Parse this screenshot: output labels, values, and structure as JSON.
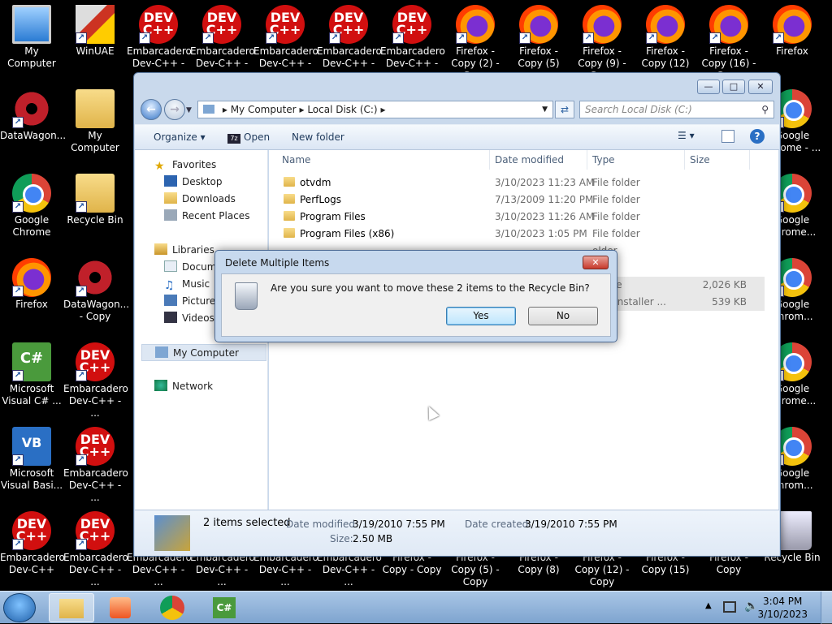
{
  "desktop": {
    "icons": [
      {
        "label": "My Computer",
        "kind": "pc"
      },
      {
        "label": "WinUAE",
        "kind": "winuae"
      },
      {
        "label": "Embarcadero Dev-C++ - ...",
        "kind": "dev"
      },
      {
        "label": "Embarcadero Dev-C++ - ...",
        "kind": "dev"
      },
      {
        "label": "Embarcadero Dev-C++ - ...",
        "kind": "dev"
      },
      {
        "label": "Embarcadero Dev-C++ - ...",
        "kind": "dev"
      },
      {
        "label": "Embarcadero Dev-C++ - ...",
        "kind": "dev"
      },
      {
        "label": "Firefox - Copy (2) - Copy",
        "kind": "ff"
      },
      {
        "label": "Firefox - Copy (5)",
        "kind": "ff"
      },
      {
        "label": "Firefox - Copy (9) - Copy",
        "kind": "ff"
      },
      {
        "label": "Firefox - Copy (12)",
        "kind": "ff"
      },
      {
        "label": "Firefox - Copy (16) - Copy",
        "kind": "ff"
      },
      {
        "label": "Firefox",
        "kind": "ff"
      },
      {
        "label": "DataWagon...",
        "kind": "star"
      },
      {
        "label": "My Computer",
        "kind": "folder"
      },
      {
        "label": "Google Chrome - ...",
        "kind": "chrome"
      },
      {
        "label": "Google Chrome",
        "kind": "chrome"
      },
      {
        "label": "Recycle Bin",
        "kind": "folder"
      },
      {
        "label": "Google Chrome...",
        "kind": "chrome"
      },
      {
        "label": "Firefox",
        "kind": "ff"
      },
      {
        "label": "DataWagon... - Copy",
        "kind": "star"
      },
      {
        "label": "Google Chrom...",
        "kind": "chrome"
      },
      {
        "label": "Microsoft Visual C# ...",
        "kind": "cs"
      },
      {
        "label": "Embarcadero Dev-C++ - ...",
        "kind": "dev"
      },
      {
        "label": "Google Chrome...",
        "kind": "chrome"
      },
      {
        "label": "Microsoft Visual Basi...",
        "kind": "vb"
      },
      {
        "label": "Embarcadero Dev-C++ - ...",
        "kind": "dev"
      },
      {
        "label": "Google Chrom...",
        "kind": "chrome"
      },
      {
        "label": "Embarcadero Dev-C++",
        "kind": "dev"
      },
      {
        "label": "Embarcadero Dev-C++ - ...",
        "kind": "dev"
      },
      {
        "label": "Embarcadero Dev-C++ - ...",
        "kind": "dev"
      },
      {
        "label": "Embarcadero Dev-C++ - ...",
        "kind": "dev"
      },
      {
        "label": "Embarcadero Dev-C++ - ...",
        "kind": "dev"
      },
      {
        "label": "Embarcadero Dev-C++ - ...",
        "kind": "dev"
      },
      {
        "label": "Firefox - Copy - Copy",
        "kind": "ff"
      },
      {
        "label": "Firefox - Copy (5) - Copy",
        "kind": "ff"
      },
      {
        "label": "Firefox - Copy (8)",
        "kind": "ff"
      },
      {
        "label": "Firefox - Copy (12) - Copy",
        "kind": "ff"
      },
      {
        "label": "Firefox - Copy (15)",
        "kind": "ff"
      },
      {
        "label": "Firefox - Copy",
        "kind": "ff"
      },
      {
        "label": "Recycle Bin",
        "kind": "bin"
      }
    ]
  },
  "explorer": {
    "address": [
      "My Computer",
      "Local Disk (C:)"
    ],
    "search_placeholder": "Search Local Disk (C:)",
    "toolbar": {
      "organize": "Organize ▾",
      "open": "Open",
      "new_folder": "New folder"
    },
    "nav": {
      "favorites": "Favorites",
      "desktop": "Desktop",
      "downloads": "Downloads",
      "recent": "Recent Places",
      "libraries": "Libraries",
      "documents": "Documents",
      "music": "Music",
      "pictures": "Pictures",
      "videos": "Videos",
      "computer": "My Computer",
      "network": "Network"
    },
    "columns": {
      "name": "Name",
      "date": "Date modified",
      "type": "Type",
      "size": "Size"
    },
    "files": [
      {
        "name": "otvdm",
        "date": "3/10/2023 11:23 AM",
        "type": "File folder",
        "size": ""
      },
      {
        "name": "PerfLogs",
        "date": "7/13/2009 11:20 PM",
        "type": "File folder",
        "size": ""
      },
      {
        "name": "Program Files",
        "date": "3/10/2023 11:26 AM",
        "type": "File folder",
        "size": ""
      },
      {
        "name": "Program Files (x86)",
        "date": "3/10/2023 1:05 PM",
        "type": "File folder",
        "size": ""
      },
      {
        "name": "",
        "date": "",
        "type": "older",
        "size": ""
      },
      {
        "name": "",
        "date": "",
        "type": "older",
        "size": ""
      },
      {
        "name": "",
        "date": "",
        "type": "rchive",
        "size": "2,026 KB"
      },
      {
        "name": "",
        "date": "",
        "type": "ows Installer ...",
        "size": "539 KB"
      }
    ],
    "details": {
      "selected": "2 items selected",
      "date_modified_label": "Date modified:",
      "date_modified": "3/19/2010 7:55 PM",
      "date_created_label": "Date created:",
      "date_created": "3/19/2010 7:55 PM",
      "size_label": "Size:",
      "size": "2.50 MB"
    }
  },
  "dialog": {
    "title": "Delete Multiple Items",
    "message": "Are you sure you want to move these 2 items to the Recycle Bin?",
    "yes": "Yes",
    "no": "No"
  },
  "taskbar": {
    "time": "3:04 PM",
    "date": "3/10/2023"
  }
}
